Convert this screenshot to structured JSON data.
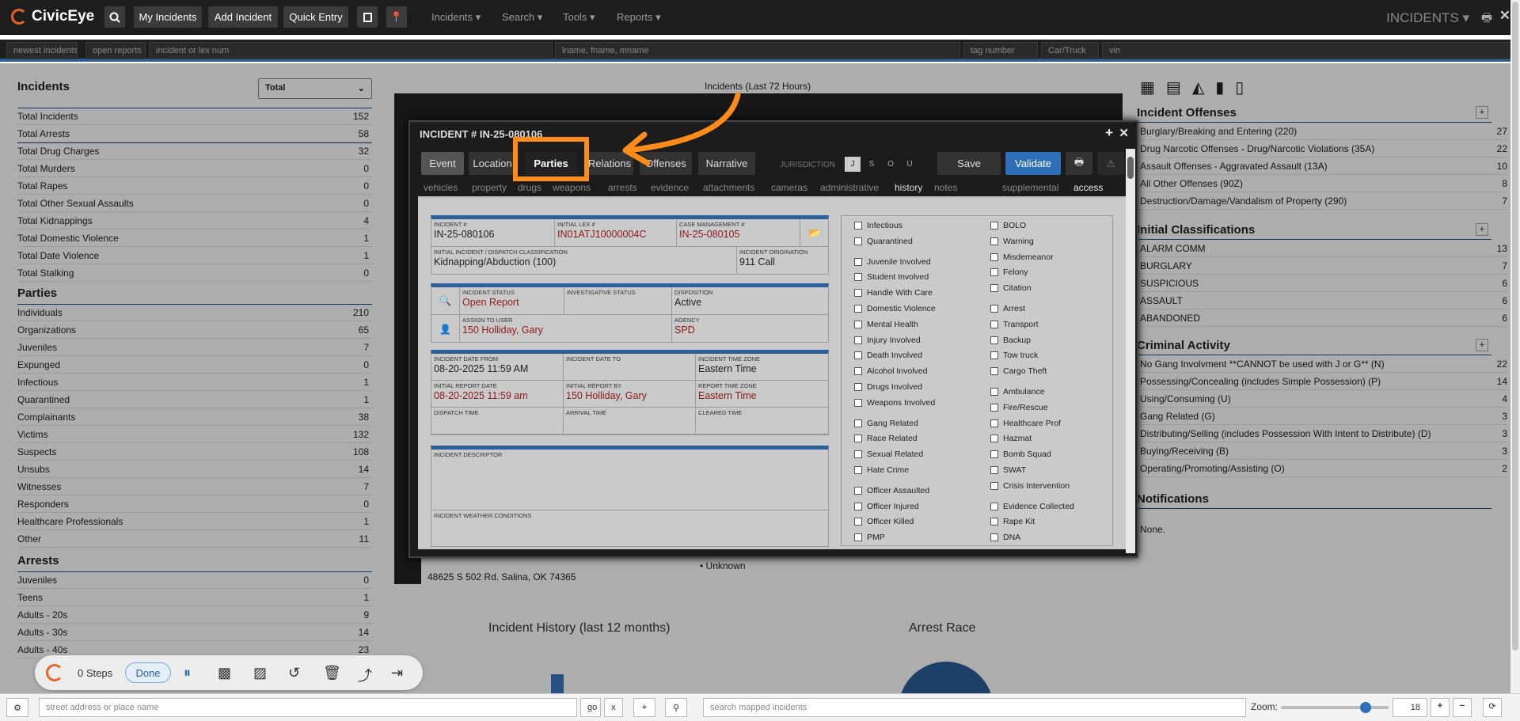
{
  "app": {
    "name": "CivicEye",
    "section": "INCIDENTS ▾"
  },
  "topbar": {
    "buttons": [
      "My Incidents",
      "Add Incident",
      "Quick Entry"
    ],
    "menus": [
      "Incidents ▾",
      "Search ▾",
      "Tools ▾",
      "Reports ▾"
    ]
  },
  "searchbar": {
    "newest": "newest incidents",
    "open": "open reports",
    "incident_placeholder": "incident or lex num",
    "name_placeholder": "lname, fname, mname",
    "tag_placeholder": "tag number",
    "car_placeholder": "Car/Truck",
    "vin_placeholder": "vin"
  },
  "left": {
    "incidents_title": "Incidents",
    "select_value": "Total",
    "incidents": [
      {
        "label": "Total Incidents",
        "value": "152"
      },
      {
        "label": "Total Arrests",
        "value": "58"
      },
      {
        "label": "Total Drug Charges",
        "value": "32"
      },
      {
        "label": "Total Murders",
        "value": "0"
      },
      {
        "label": "Total Rapes",
        "value": "0"
      },
      {
        "label": "Total Other Sexual Assaults",
        "value": "0"
      },
      {
        "label": "Total Kidnappings",
        "value": "4"
      },
      {
        "label": "Total Domestic Violence",
        "value": "1"
      },
      {
        "label": "Total Date Violence",
        "value": "1"
      },
      {
        "label": "Total Stalking",
        "value": "0"
      }
    ],
    "parties_title": "Parties",
    "parties": [
      {
        "label": "Individuals",
        "value": "210"
      },
      {
        "label": "Organizations",
        "value": "65"
      },
      {
        "label": "Juveniles",
        "value": "7"
      },
      {
        "label": "Expunged",
        "value": "0"
      },
      {
        "label": "Infectious",
        "value": "1"
      },
      {
        "label": "Quarantined",
        "value": "1"
      },
      {
        "label": "Complainants",
        "value": "38"
      },
      {
        "label": "Victims",
        "value": "132"
      },
      {
        "label": "Suspects",
        "value": "108"
      },
      {
        "label": "Unsubs",
        "value": "14"
      },
      {
        "label": "Witnesses",
        "value": "7"
      },
      {
        "label": "Responders",
        "value": "0"
      },
      {
        "label": "Healthcare Professionals",
        "value": "1"
      },
      {
        "label": "Other",
        "value": "11"
      }
    ],
    "arrests_title": "Arrests",
    "arrests": [
      {
        "label": "Juveniles",
        "value": "0"
      },
      {
        "label": "Teens",
        "value": "1"
      },
      {
        "label": "Adults - 20s",
        "value": "9"
      },
      {
        "label": "Adults - 30s",
        "value": "14"
      },
      {
        "label": "Adults - 40s",
        "value": "23"
      }
    ]
  },
  "center": {
    "chart_title": "Incidents (Last 72 Hours)",
    "history_title": "Incident History (last 12 months)",
    "race_title": "Arrest Race",
    "address": "48625 S 502 Rd. Salina, OK 74365",
    "unknown": "Unknown"
  },
  "right": {
    "offenses_title": "Incident Offenses",
    "offenses": [
      {
        "label": "Burglary/Breaking and Entering (220)",
        "value": "27"
      },
      {
        "label": "Drug Narcotic Offenses - Drug/Narcotic Violations (35A)",
        "value": "22"
      },
      {
        "label": "Assault Offenses - Aggravated Assault (13A)",
        "value": "10"
      },
      {
        "label": "All Other Offenses (90Z)",
        "value": "8"
      },
      {
        "label": "Destruction/Damage/Vandalism of Property (290)",
        "value": "7"
      }
    ],
    "class_title": "Initial Classifications",
    "classifications": [
      {
        "label": "ALARM COMM",
        "value": "13"
      },
      {
        "label": "BURGLARY",
        "value": "7"
      },
      {
        "label": "SUSPICIOUS",
        "value": "6"
      },
      {
        "label": "ASSAULT",
        "value": "6"
      },
      {
        "label": "ABANDONED",
        "value": "6"
      }
    ],
    "criminal_title": "Criminal Activity",
    "criminal": [
      {
        "label": "No Gang Involvment **CANNOT be used with J or G** (N)",
        "value": "22"
      },
      {
        "label": "Possessing/Concealing (includes Simple Possession) (P)",
        "value": "14"
      },
      {
        "label": "Using/Consuming (U)",
        "value": "4"
      },
      {
        "label": "Gang Related (G)",
        "value": "3"
      },
      {
        "label": "Distributing/Selling (includes Possession With Intent to Distribute) (D)",
        "value": "3"
      },
      {
        "label": "Buying/Receiving (B)",
        "value": "3"
      },
      {
        "label": "Operating/Promoting/Assisting (O)",
        "value": "2"
      }
    ],
    "notif_title": "Notifications",
    "notif_text": "None."
  },
  "modal": {
    "title": "INCIDENT # IN-25-080106",
    "tabs": [
      "Event",
      "Location",
      "Parties",
      "Relations",
      "Offenses",
      "Narrative"
    ],
    "jurisdiction_label": "JURISDICTION",
    "jurisdiction": [
      "J",
      "S",
      "O",
      "U"
    ],
    "save": "Save",
    "validate": "Validate",
    "subtabs": [
      "vehicles",
      "property",
      "drugs",
      "weapons",
      "arrests",
      "evidence",
      "attachments",
      "cameras",
      "administrative",
      "history",
      "notes"
    ],
    "supplemental": "supplemental",
    "access": "access",
    "fields": {
      "incident_num_lbl": "INCIDENT #",
      "incident_num": "IN-25-080106",
      "lex_lbl": "INITIAL LEX #",
      "lex": "IN01ATJ10000004C",
      "case_lbl": "CASE MANAGEMENT #",
      "case": "IN-25-080105",
      "classification_lbl": "INITIAL INCIDENT / DISPATCH CLASSIFICATION",
      "classification": "Kidnapping/Abduction (100)",
      "origination_lbl": "INCIDENT ORIGINATION",
      "origination": "911 Call",
      "status_lbl": "INCIDENT STATUS",
      "status": "Open Report",
      "inv_status_lbl": "INVESTIGATIVE STATUS",
      "inv_status": "",
      "disposition_lbl": "DISPOSITION",
      "disposition": "Active",
      "assign_lbl": "ASSIGN TO USER",
      "assign": "150 Holliday, Gary",
      "agency_lbl": "AGENCY",
      "agency": "SPD",
      "date_from_lbl": "INCIDENT DATE FROM",
      "date_from": "08-20-2025 11:59 AM",
      "date_to_lbl": "INCIDENT DATE TO",
      "date_to": "",
      "tz_lbl": "INCIDENT TIME ZONE",
      "tz": "Eastern Time",
      "report_date_lbl": "INITIAL REPORT DATE",
      "report_date": "08-20-2025 11:59 am",
      "report_by_lbl": "INITIAL REPORT BY",
      "report_by": "150 Holliday, Gary",
      "report_tz_lbl": "REPORT TIME ZONE",
      "report_tz": "Eastern Time",
      "dispatch_lbl": "DISPATCH TIME",
      "arrival_lbl": "ARRIVAL TIME",
      "cleared_lbl": "CLEARED TIME",
      "descriptor_lbl": "INCIDENT DESCRIPTOR",
      "weather_lbl": "INCIDENT WEATHER CONDITIONS"
    },
    "checks_left": [
      "Infectious",
      "Quarantined",
      "",
      "Juvenile Involved",
      "Student Involved",
      "Handle With Care",
      "Domestic Violence",
      "Mental Health",
      "Injury Involved",
      "Death Involved",
      "Alcohol Involved",
      "Drugs Involved",
      "Weapons Involved",
      "",
      "Gang Related",
      "Race Related",
      "Sexual Related",
      "Hate Crime",
      "",
      "Officer Assaulted",
      "Officer Injured",
      "Officer Killed",
      "PMP"
    ],
    "checks_right": [
      "BOLO",
      "Warning",
      "Misdemeanor",
      "Felony",
      "Citation",
      "",
      "Arrest",
      "Transport",
      "Backup",
      "Tow truck",
      "Cargo Theft",
      "",
      "Ambulance",
      "Fire/Rescue",
      "Healthcare Prof",
      "Hazmat",
      "Bomb Squad",
      "SWAT",
      "Crisis Intervention",
      "",
      "Evidence Collected",
      "Rape Kit",
      "DNA"
    ]
  },
  "widget": {
    "steps": "0 Steps",
    "done": "Done"
  },
  "bottombar": {
    "address_placeholder": "street address or place name",
    "go": "go",
    "x": "x",
    "mapped_placeholder": "search mapped incidents",
    "zoom_label": "Zoom:",
    "zoom_value": "18"
  },
  "colors": {
    "accent": "#2d5f9a",
    "brand": "#e8622a",
    "highlight": "#ff8c1a"
  }
}
